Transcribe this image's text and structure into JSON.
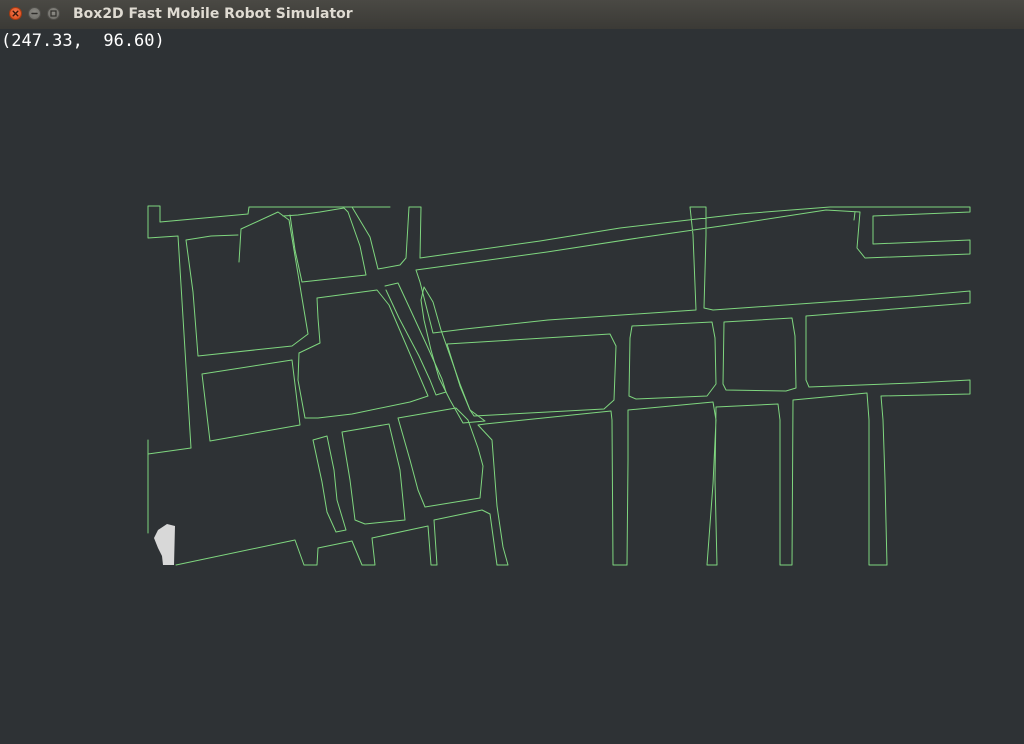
{
  "window": {
    "title": "Box2D Fast Mobile Robot Simulator",
    "buttons": [
      "close",
      "minimize",
      "maximize"
    ]
  },
  "viewport": {
    "coordinate_readout": "(247.33,  96.60)",
    "map_line_color": "#7fd67f",
    "background_color": "#2e3235",
    "robot_color": "#d8d8d8"
  }
}
